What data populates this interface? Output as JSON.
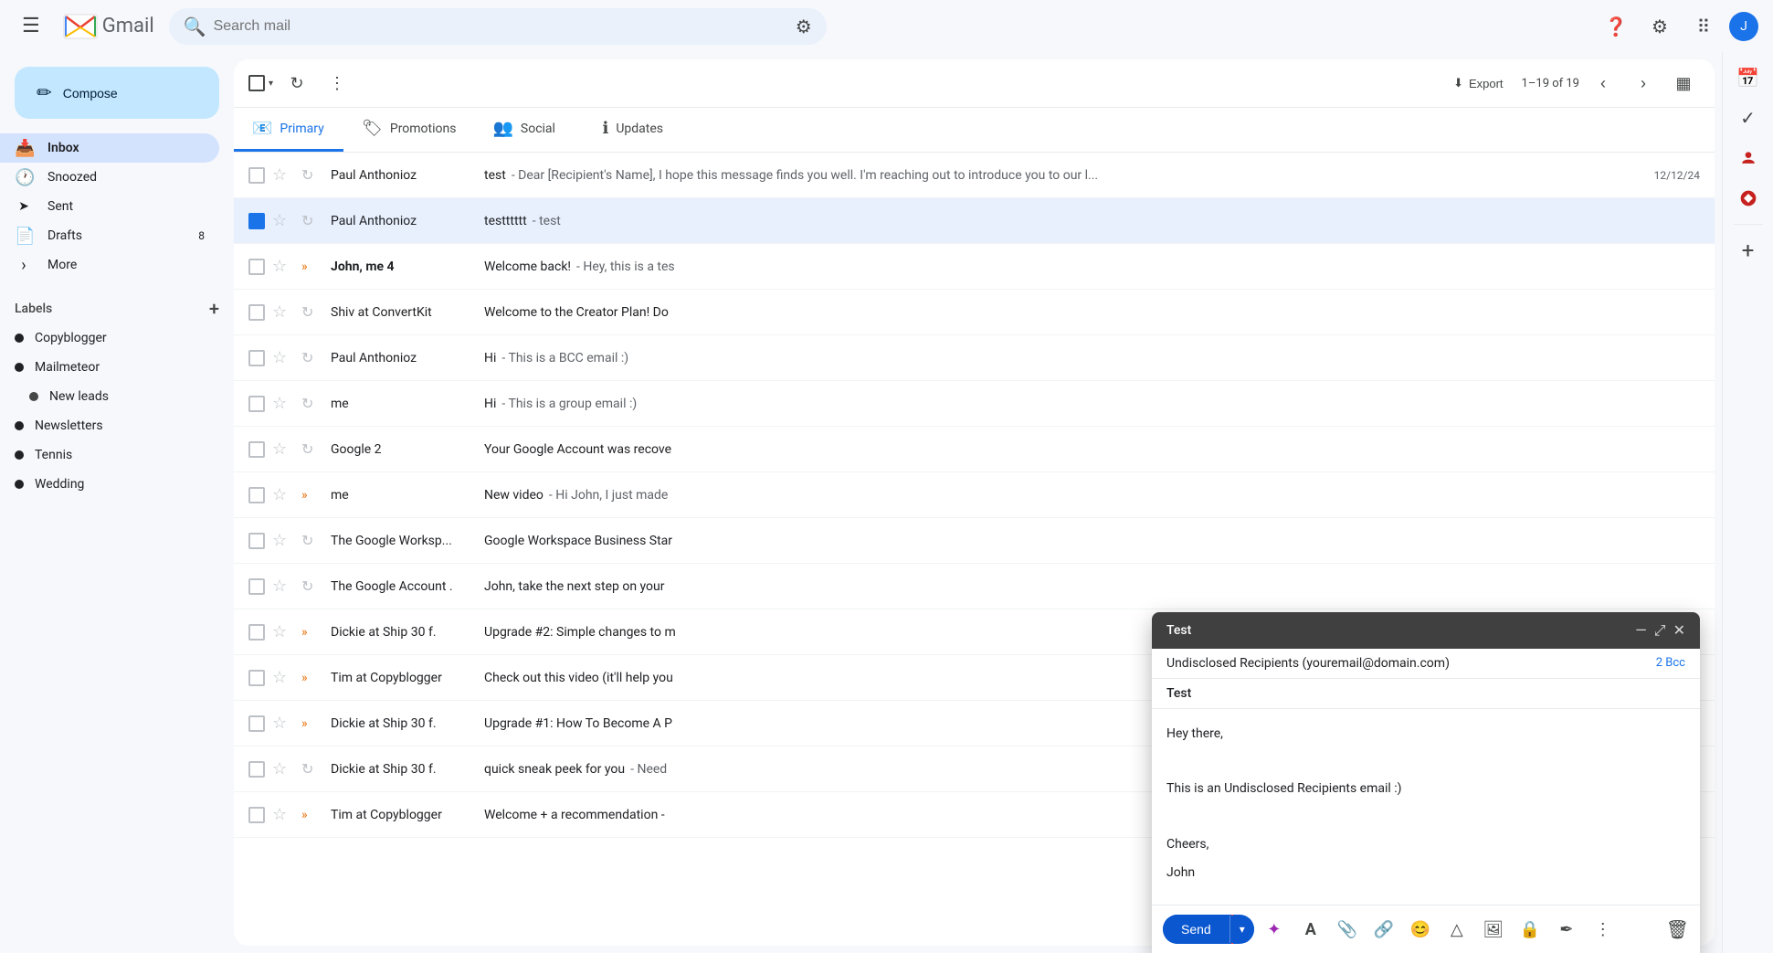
{
  "app": {
    "title": "Gmail",
    "logo_m": "M",
    "logo_text": "Gmail",
    "search_placeholder": "Search mail"
  },
  "compose_button": "Compose",
  "nav": {
    "items": [
      {
        "id": "inbox",
        "label": "Inbox",
        "icon": "📥",
        "active": true,
        "count": ""
      },
      {
        "id": "snoozed",
        "label": "Snoozed",
        "icon": "🕐",
        "active": false,
        "count": ""
      },
      {
        "id": "sent",
        "label": "Sent",
        "icon": "➤",
        "active": false,
        "count": ""
      },
      {
        "id": "drafts",
        "label": "Drafts",
        "icon": "📄",
        "active": false,
        "count": "8"
      },
      {
        "id": "more",
        "label": "More",
        "icon": "▾",
        "active": false,
        "count": ""
      }
    ]
  },
  "labels": {
    "header": "Labels",
    "add_icon": "+",
    "items": [
      {
        "id": "copyblogger",
        "label": "Copyblogger",
        "color": "#202124",
        "sub": false
      },
      {
        "id": "mailmeteor",
        "label": "Mailmeteor",
        "color": "#202124",
        "sub": false
      },
      {
        "id": "new-leads",
        "label": "New leads",
        "color": "#444746",
        "sub": true
      },
      {
        "id": "newsletters",
        "label": "Newsletters",
        "color": "#202124",
        "sub": false
      },
      {
        "id": "tennis",
        "label": "Tennis",
        "color": "#202124",
        "sub": false
      },
      {
        "id": "wedding",
        "label": "Wedding",
        "color": "#202124",
        "sub": false
      }
    ]
  },
  "toolbar": {
    "export_label": "Export",
    "count_label": "1–19 of 19"
  },
  "tabs": [
    {
      "id": "primary",
      "label": "Primary",
      "icon": "📧",
      "active": true
    },
    {
      "id": "promotions",
      "label": "Promotions",
      "icon": "🏷",
      "active": false
    },
    {
      "id": "social",
      "label": "Social",
      "icon": "👥",
      "active": false
    },
    {
      "id": "updates",
      "label": "Updates",
      "icon": "ℹ",
      "active": false
    }
  ],
  "emails": [
    {
      "id": 1,
      "sender": "Paul Anthonioz",
      "subject": "test",
      "preview": "Dear [Recipient's Name], I hope this message finds you well. I'm reaching out to introduce you to our l...",
      "date": "12/12/24",
      "unread": false,
      "starred": false,
      "priority": false,
      "selected": false
    },
    {
      "id": 2,
      "sender": "Paul Anthonioz",
      "subject": "testttttt",
      "preview": "test",
      "date": "",
      "unread": false,
      "starred": false,
      "priority": false,
      "selected": true
    },
    {
      "id": 3,
      "sender": "John, me 4",
      "subject": "Welcome back!",
      "preview": "Hey, this is a tes",
      "date": "",
      "unread": true,
      "starred": false,
      "priority": true,
      "selected": false
    },
    {
      "id": 4,
      "sender": "Shiv at ConvertKit",
      "subject": "Welcome to the Creator Plan! Do",
      "preview": "",
      "date": "",
      "unread": false,
      "starred": false,
      "priority": false,
      "selected": false
    },
    {
      "id": 5,
      "sender": "Paul Anthonioz",
      "subject": "Hi",
      "preview": "This is a BCC email :)",
      "date": "",
      "unread": false,
      "starred": false,
      "priority": false,
      "selected": false
    },
    {
      "id": 6,
      "sender": "me",
      "subject": "Hi",
      "preview": "This is a group email :)",
      "date": "",
      "unread": false,
      "starred": false,
      "priority": false,
      "selected": false
    },
    {
      "id": 7,
      "sender": "Google 2",
      "subject": "Your Google Account was recove",
      "preview": "",
      "date": "",
      "unread": false,
      "starred": false,
      "priority": false,
      "selected": false
    },
    {
      "id": 8,
      "sender": "me",
      "subject": "New video",
      "preview": "Hi John, I just made",
      "date": "",
      "unread": false,
      "starred": false,
      "priority": true,
      "selected": false
    },
    {
      "id": 9,
      "sender": "The Google Worksp...",
      "subject": "Google Workspace Business Star",
      "preview": "",
      "date": "",
      "unread": false,
      "starred": false,
      "priority": false,
      "selected": false
    },
    {
      "id": 10,
      "sender": "The Google Account .",
      "subject": "John, take the next step on your",
      "preview": "",
      "date": "",
      "unread": false,
      "starred": false,
      "priority": false,
      "selected": false
    },
    {
      "id": 11,
      "sender": "Dickie at Ship 30 f.",
      "subject": "Upgrade #2: Simple changes to m",
      "preview": "",
      "date": "",
      "unread": false,
      "starred": false,
      "priority": true,
      "selected": false
    },
    {
      "id": 12,
      "sender": "Tim at Copyblogger",
      "subject": "Check out this video (it'll help you",
      "preview": "",
      "date": "",
      "unread": false,
      "starred": false,
      "priority": true,
      "selected": false
    },
    {
      "id": 13,
      "sender": "Dickie at Ship 30 f.",
      "subject": "Upgrade #1: How To Become A P",
      "preview": "",
      "date": "",
      "unread": false,
      "starred": false,
      "priority": true,
      "selected": false
    },
    {
      "id": 14,
      "sender": "Dickie at Ship 30 f.",
      "subject": "quick sneak peek for you",
      "preview": "Need",
      "date": "",
      "unread": false,
      "starred": false,
      "priority": false,
      "selected": false
    },
    {
      "id": 15,
      "sender": "Tim at Copyblogger",
      "subject": "Welcome + a recommendation -",
      "preview": "",
      "date": "",
      "unread": false,
      "starred": false,
      "priority": true,
      "selected": false
    }
  ],
  "compose_window": {
    "title": "Test",
    "to_label": "Undisclosed Recipients (youremail@domain.com)",
    "bcc_label": "2 Bcc",
    "subject": "Test",
    "body_lines": [
      "Hey there,",
      "",
      "This is an Undisclosed Recipients email :)",
      "",
      "Cheers,",
      "John"
    ],
    "send_label": "Send"
  },
  "right_panel_icons": [
    "📅",
    "✓",
    "👤",
    "+"
  ]
}
